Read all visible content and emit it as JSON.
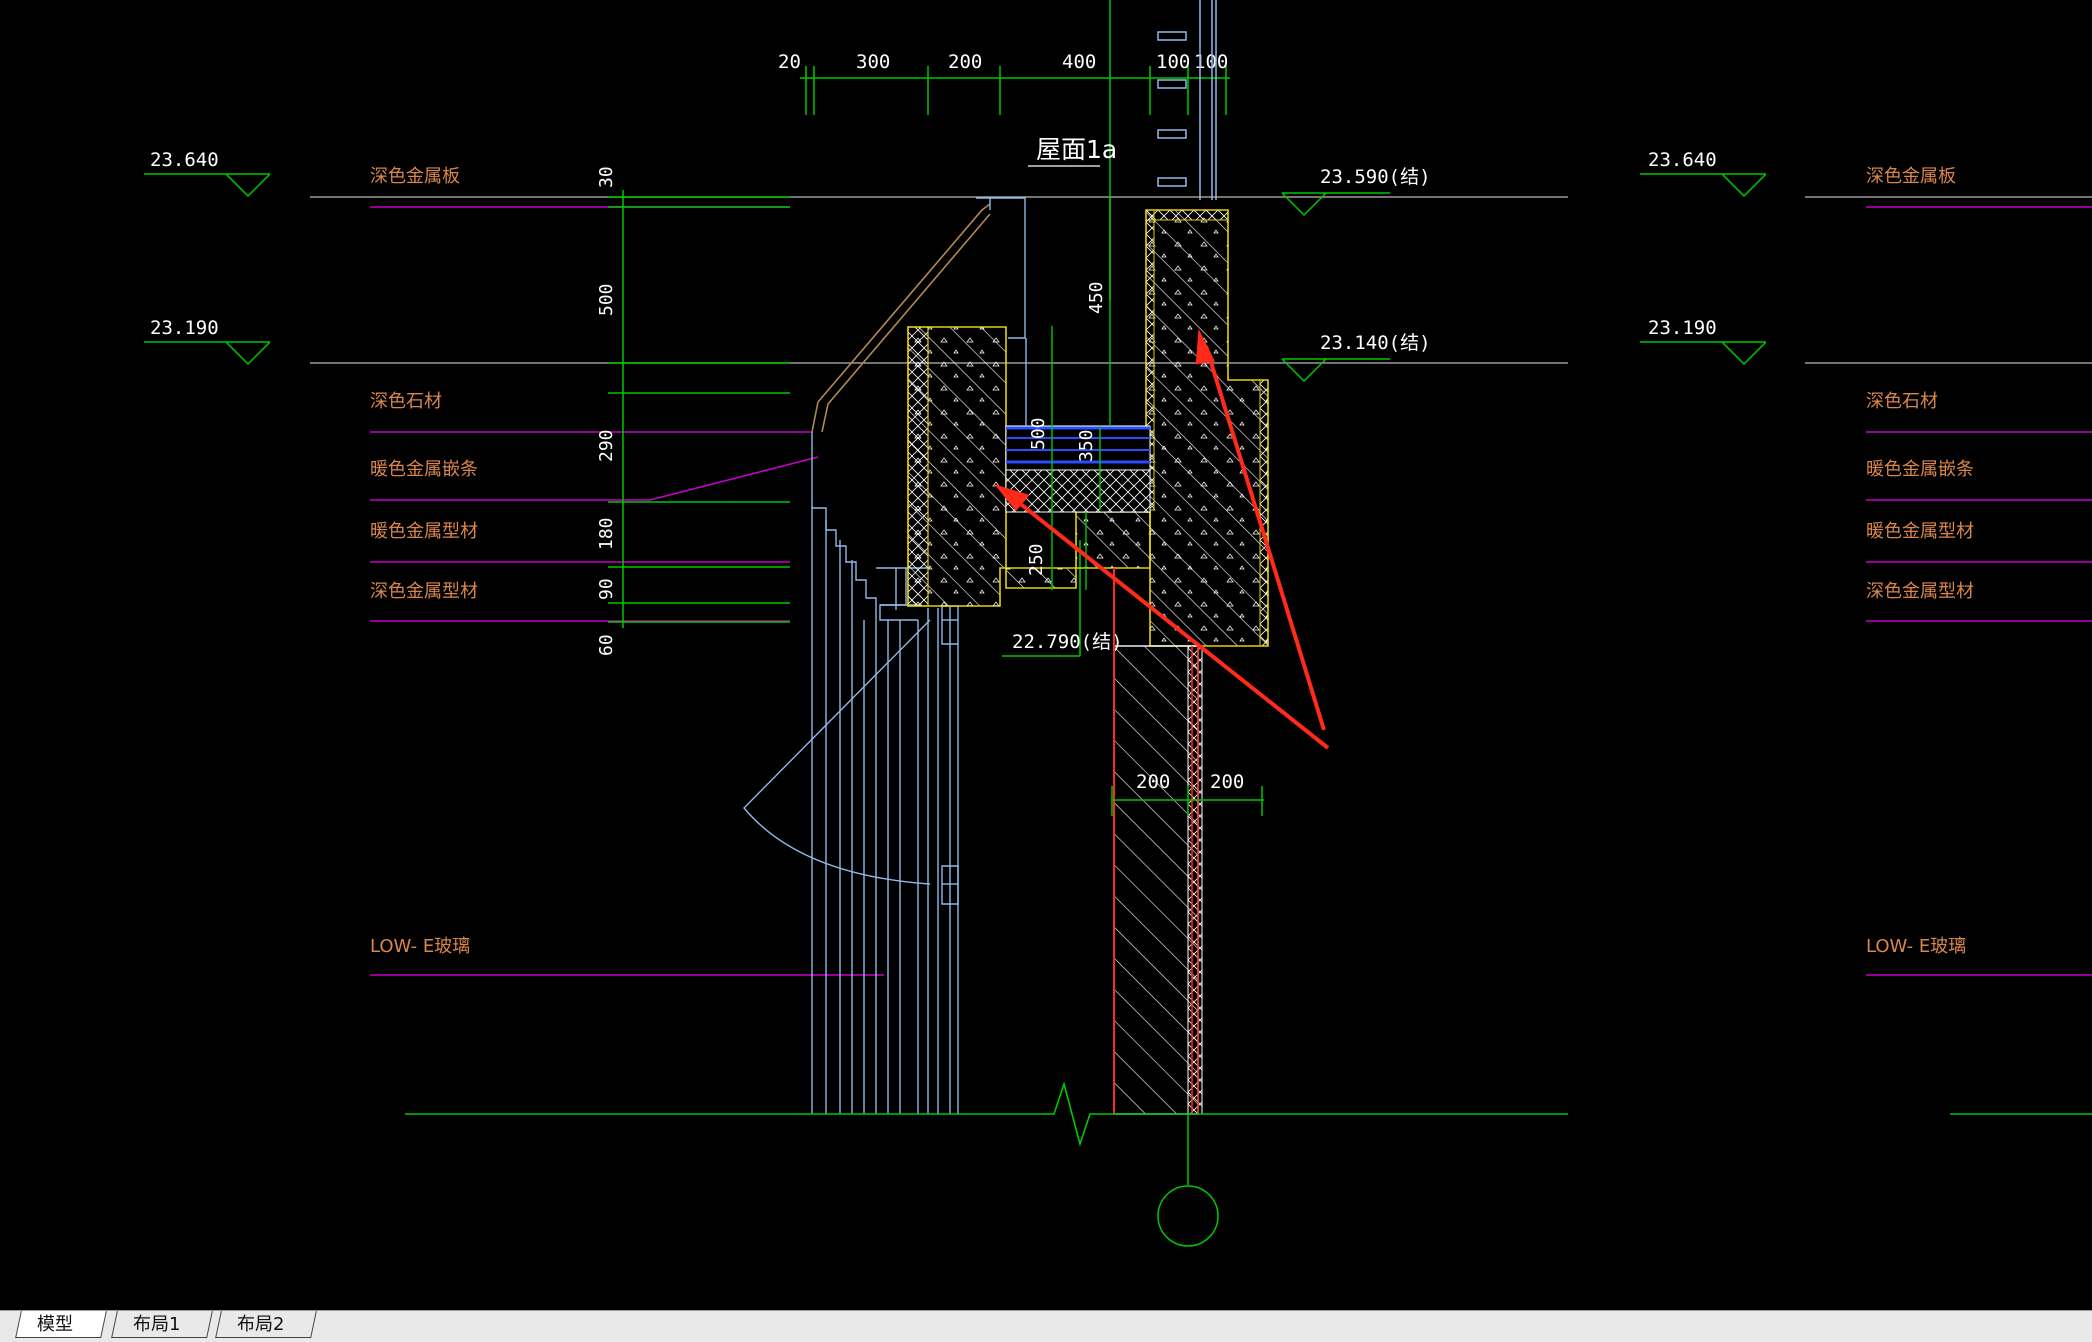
{
  "drawing": {
    "top_dims": [
      "20",
      "300",
      "200",
      "400",
      "100",
      "100"
    ],
    "roof_label": "屋面1a",
    "levels": {
      "left_top": "23.640",
      "left_mid": "23.190",
      "right_top": "23.640",
      "right_mid": "23.190",
      "struct_top": "23.590(结)",
      "struct_mid": "23.140(结)",
      "struct_low": "22.790(结)"
    },
    "left_notes": [
      "深色金属板",
      "深色石材",
      "暖色金属嵌条",
      "暖色金属型材",
      "深色金属型材",
      "LOW- E玻璃"
    ],
    "right_notes": [
      "深色金属板",
      "深色石材",
      "暖色金属嵌条",
      "暖色金属型材",
      "深色金属型材",
      "LOW- E玻璃"
    ],
    "vertical_dims": [
      "30",
      "500",
      "290",
      "180",
      "90",
      "60"
    ],
    "inner_dims": [
      "450",
      "500",
      "350",
      "250"
    ],
    "bottom_dims": [
      "200",
      "200"
    ],
    "colors": {
      "green": "#00c800",
      "magenta": "#c800c8",
      "yellow": "#e6d200",
      "cyan": "#8fb8e8",
      "red": "#ff2a1a",
      "blue": "#2a4dff"
    }
  },
  "tabs": [
    {
      "label": "模型",
      "active": true
    },
    {
      "label": "布局1",
      "active": false
    },
    {
      "label": "布局2",
      "active": false
    }
  ]
}
